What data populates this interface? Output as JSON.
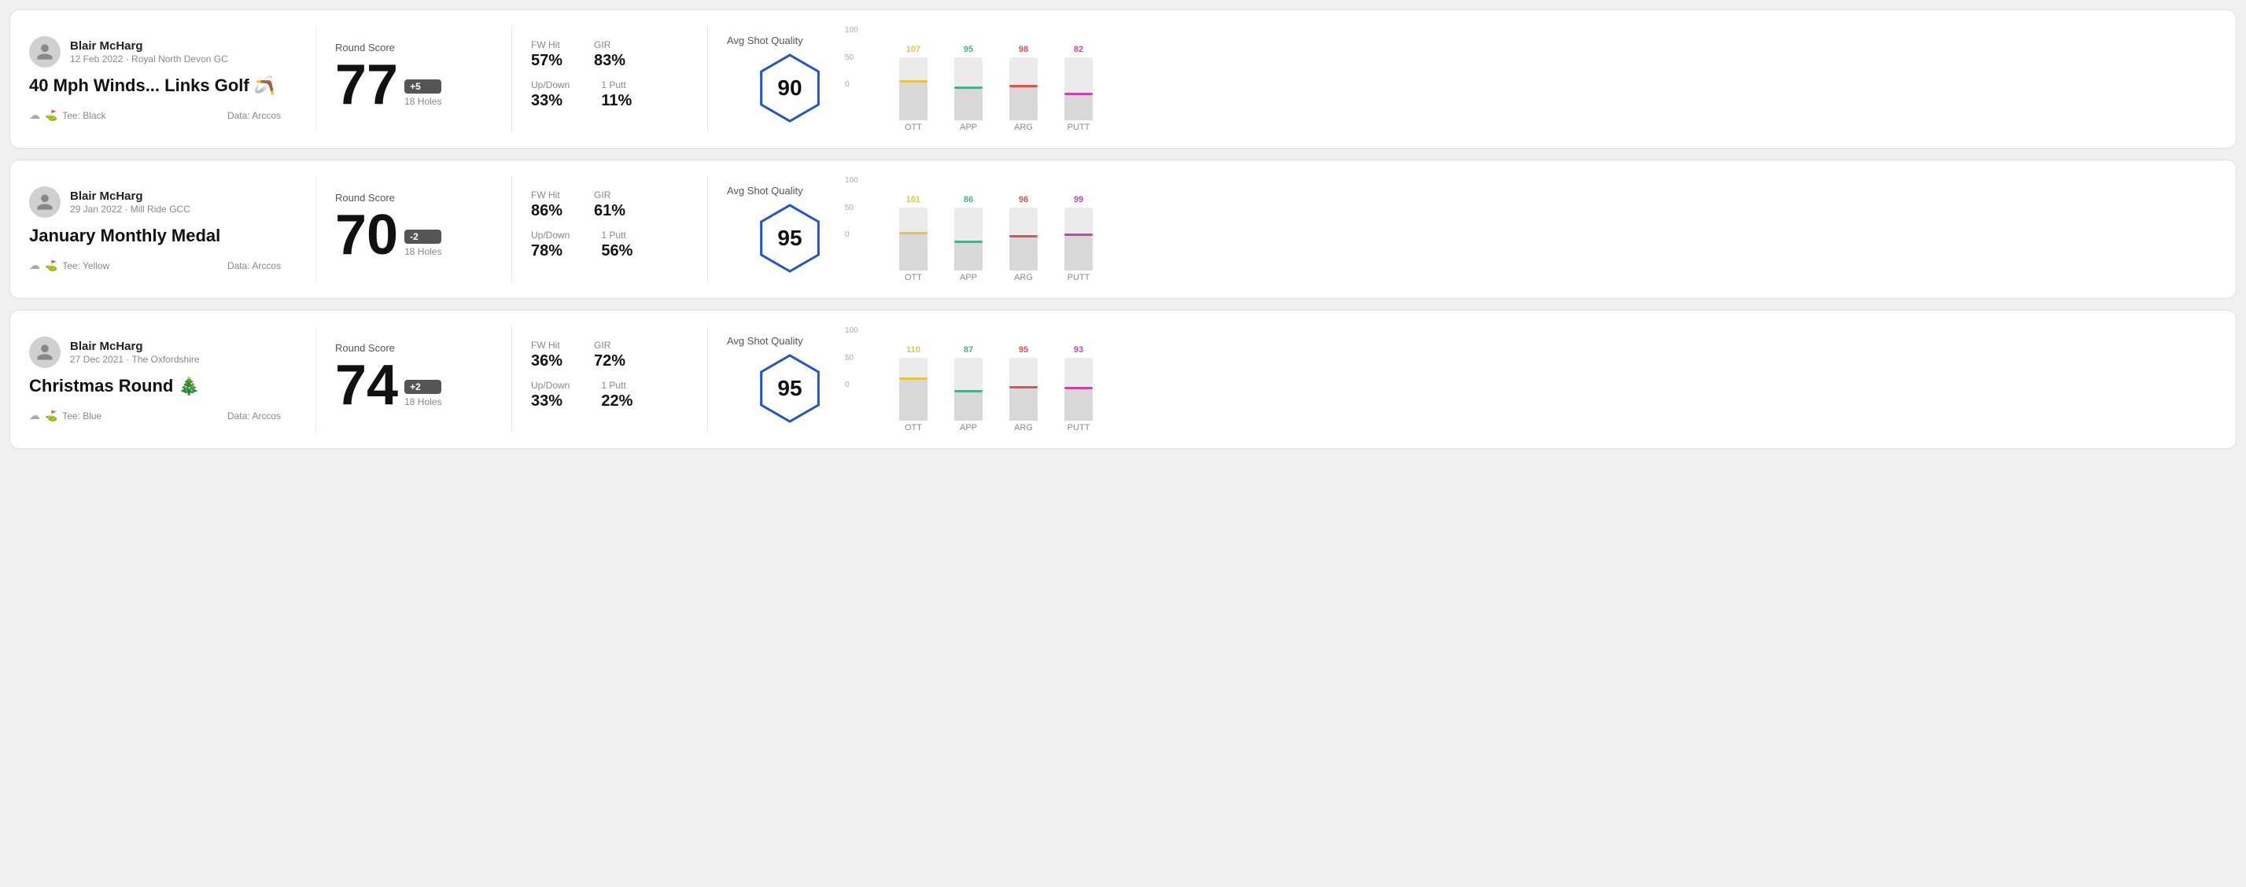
{
  "rounds": [
    {
      "id": "round1",
      "user_name": "Blair McHarg",
      "user_meta": "12 Feb 2022 · Royal North Devon GC",
      "round_title": "40 Mph Winds... Links Golf 🪃",
      "tee": "Tee: Black",
      "data_source": "Data: Arccos",
      "round_score_label": "Round Score",
      "score": "77",
      "badge": "+5",
      "holes": "18 Holes",
      "fw_hit_label": "FW Hit",
      "fw_hit_val": "57%",
      "gir_label": "GIR",
      "gir_val": "83%",
      "updown_label": "Up/Down",
      "updown_val": "33%",
      "one_putt_label": "1 Putt",
      "one_putt_val": "11%",
      "avg_shot_quality_label": "Avg Shot Quality",
      "quality_score": "90",
      "chart": {
        "columns": [
          {
            "label": "OTT",
            "top_val": "107",
            "top_color": "#e8c240",
            "bar_height_pct": 60
          },
          {
            "label": "APP",
            "top_val": "95",
            "top_color": "#4caf88",
            "bar_height_pct": 50
          },
          {
            "label": "ARG",
            "top_val": "98",
            "top_color": "#e05050",
            "bar_height_pct": 52
          },
          {
            "label": "PUTT",
            "top_val": "82",
            "top_color": "#cc44aa",
            "bar_height_pct": 40
          }
        ],
        "y_labels": [
          "100",
          "50",
          "0"
        ]
      }
    },
    {
      "id": "round2",
      "user_name": "Blair McHarg",
      "user_meta": "29 Jan 2022 · Mill Ride GCC",
      "round_title": "January Monthly Medal",
      "tee": "Tee: Yellow",
      "data_source": "Data: Arccos",
      "round_score_label": "Round Score",
      "score": "70",
      "badge": "-2",
      "holes": "18 Holes",
      "fw_hit_label": "FW Hit",
      "fw_hit_val": "86%",
      "gir_label": "GIR",
      "gir_val": "61%",
      "updown_label": "Up/Down",
      "updown_val": "78%",
      "one_putt_label": "1 Putt",
      "one_putt_val": "56%",
      "avg_shot_quality_label": "Avg Shot Quality",
      "quality_score": "95",
      "chart": {
        "columns": [
          {
            "label": "OTT",
            "top_val": "101",
            "top_color": "#e8c240",
            "bar_height_pct": 58
          },
          {
            "label": "APP",
            "top_val": "86",
            "top_color": "#4caf88",
            "bar_height_pct": 44
          },
          {
            "label": "ARG",
            "top_val": "96",
            "top_color": "#e05050",
            "bar_height_pct": 52
          },
          {
            "label": "PUTT",
            "top_val": "99",
            "top_color": "#cc44aa",
            "bar_height_pct": 55
          }
        ],
        "y_labels": [
          "100",
          "50",
          "0"
        ]
      }
    },
    {
      "id": "round3",
      "user_name": "Blair McHarg",
      "user_meta": "27 Dec 2021 · The Oxfordshire",
      "round_title": "Christmas Round 🎄",
      "tee": "Tee: Blue",
      "data_source": "Data: Arccos",
      "round_score_label": "Round Score",
      "score": "74",
      "badge": "+2",
      "holes": "18 Holes",
      "fw_hit_label": "FW Hit",
      "fw_hit_val": "36%",
      "gir_label": "GIR",
      "gir_val": "72%",
      "updown_label": "Up/Down",
      "updown_val": "33%",
      "one_putt_label": "1 Putt",
      "one_putt_val": "22%",
      "avg_shot_quality_label": "Avg Shot Quality",
      "quality_score": "95",
      "chart": {
        "columns": [
          {
            "label": "OTT",
            "top_val": "110",
            "top_color": "#e8c240",
            "bar_height_pct": 65
          },
          {
            "label": "APP",
            "top_val": "87",
            "top_color": "#4caf88",
            "bar_height_pct": 45
          },
          {
            "label": "ARG",
            "top_val": "95",
            "top_color": "#e05050",
            "bar_height_pct": 51
          },
          {
            "label": "PUTT",
            "top_val": "93",
            "top_color": "#cc44aa",
            "bar_height_pct": 50
          }
        ],
        "y_labels": [
          "100",
          "50",
          "0"
        ]
      }
    }
  ]
}
